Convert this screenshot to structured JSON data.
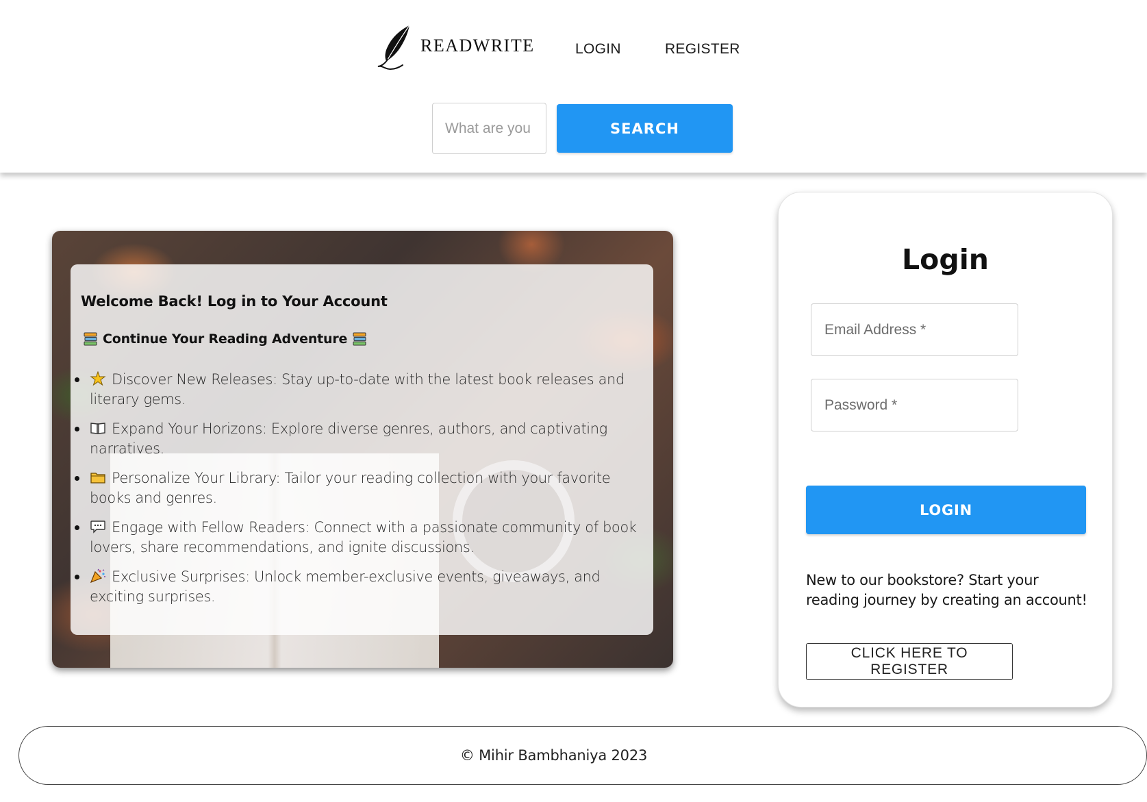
{
  "header": {
    "brand": {
      "name": "READWRITE",
      "logo_icon": "quill-feather-icon"
    },
    "nav": {
      "login_label": "LOGIN",
      "register_label": "REGISTER"
    },
    "search": {
      "placeholder": "What are you",
      "button_label": "SEARCH"
    }
  },
  "hero": {
    "title": "Welcome Back! Log in to Your Account",
    "subtitle": "Continue Your Reading Adventure",
    "subtitle_icon": "books-icon",
    "features": [
      {
        "icon": "sparkle-icon",
        "text": "Discover New Releases: Stay up-to-date with the latest book releases and literary gems."
      },
      {
        "icon": "open-book-icon",
        "text": "Expand Your Horizons: Explore diverse genres, authors, and captivating narratives."
      },
      {
        "icon": "folder-icon",
        "text": "Personalize Your Library: Tailor your reading collection with your favorite books and genres."
      },
      {
        "icon": "speech-bubble-icon",
        "text": "Engage with Fellow Readers: Connect with a passionate community of book lovers, share recommendations, and ignite discussions."
      },
      {
        "icon": "party-popper-icon",
        "text": "Exclusive Surprises: Unlock member-exclusive events, giveaways, and exciting surprises."
      }
    ]
  },
  "login": {
    "title": "Login",
    "email_placeholder": "Email Address *",
    "password_placeholder": "Password *",
    "button_label": "LOGIN",
    "register_prompt": "New to our bookstore? Start your reading journey by creating an account!",
    "register_button_label": "CLICK HERE TO REGISTER"
  },
  "footer": {
    "text": "© Mihir Bambhaniya 2023"
  },
  "colors": {
    "accent": "#2196f3",
    "text": "#1a1a1a",
    "border": "#cfcfcf"
  }
}
